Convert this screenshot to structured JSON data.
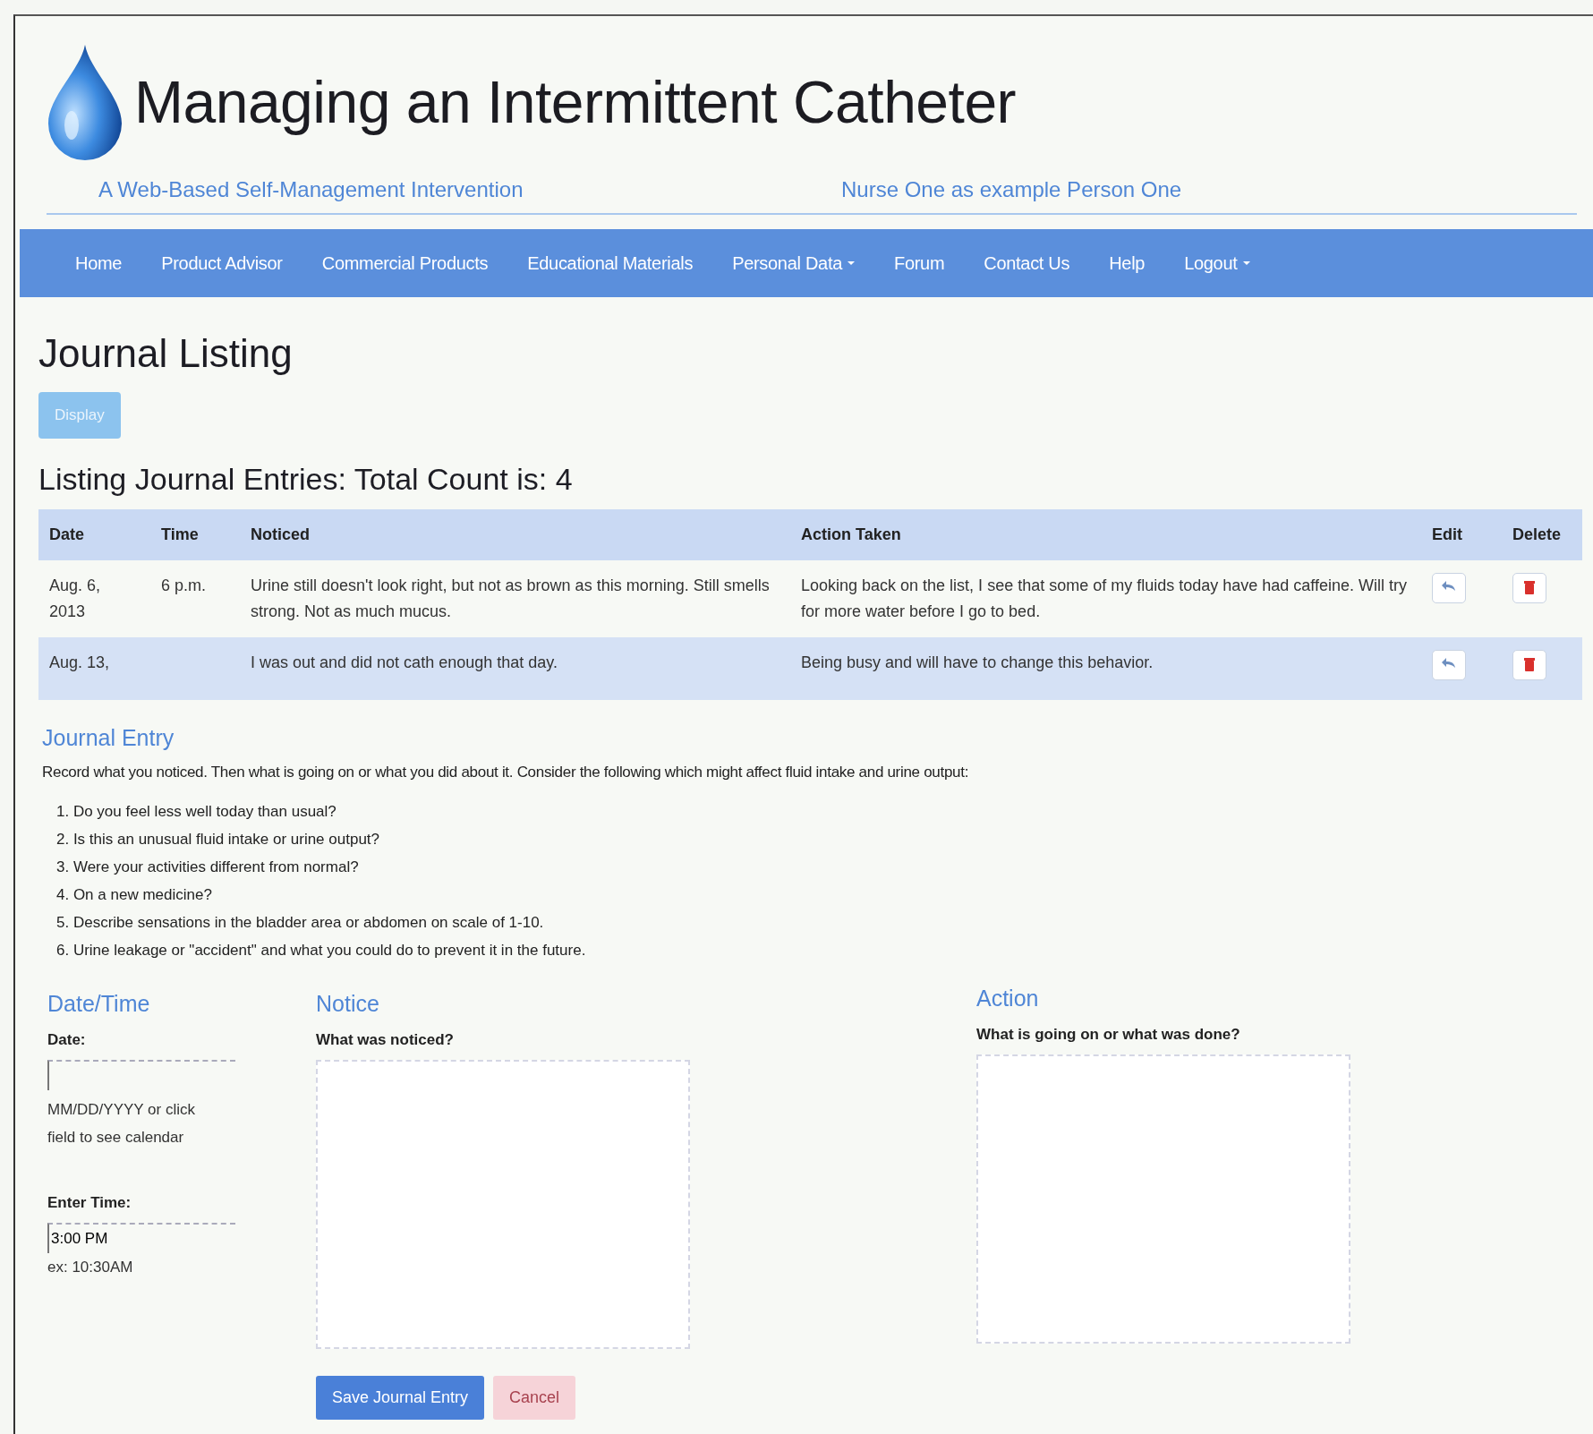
{
  "header": {
    "title": "Managing an Intermittent Catheter",
    "tagline": "A Web-Based Self-Management Intervention",
    "user": "Nurse One as example Person One"
  },
  "nav": [
    {
      "label": "Home",
      "dropdown": false
    },
    {
      "label": "Product Advisor",
      "dropdown": false
    },
    {
      "label": "Commercial Products",
      "dropdown": false
    },
    {
      "label": "Educational Materials",
      "dropdown": false
    },
    {
      "label": "Personal Data",
      "dropdown": true
    },
    {
      "label": "Forum",
      "dropdown": false
    },
    {
      "label": "Contact Us",
      "dropdown": false
    },
    {
      "label": "Help",
      "dropdown": false
    },
    {
      "label": "Logout",
      "dropdown": true
    }
  ],
  "listing": {
    "title": "Journal Listing",
    "display_button": {
      "label": "Display",
      "disabled": true
    },
    "subtitle": "Listing Journal Entries: Total Count is: 4",
    "columns": [
      "Date",
      "Time",
      "Noticed",
      "Action Taken",
      "Edit",
      "Delete"
    ],
    "rows": [
      {
        "date": "Aug. 6, 2013",
        "time": "6 p.m.",
        "noticed": "Urine still doesn't look right, but not as brown as this morning. Still smells strong. Not as much mucus.",
        "action": "Looking back on the list, I see that some of my fluids today have had caffeine. Will try for more water before I go to bed."
      },
      {
        "date": "Aug. 13,",
        "time": "",
        "noticed": "I was out and did not cath enough that day.",
        "action": "Being busy and will have to change this behavior."
      }
    ]
  },
  "entry": {
    "title": "Journal Entry",
    "intro": "Record what you noticed. Then what is going on or what you did about it. Consider the following which might affect fluid intake and urine output:",
    "questions": [
      "1. Do you feel less well today than usual?",
      "2. Is this an unusual fluid intake or urine output?",
      "3. Were your activities different from normal?",
      "4. On a new medicine?",
      "5. Describe sensations in the bladder area or abdomen on scale of 1-10.",
      "6. Urine leakage or \"accident\" and what you could do to prevent it in the future."
    ],
    "datetime": {
      "heading": "Date/Time",
      "date_label": "Date:",
      "date_hint": "MM/DD/YYYY or click field to see calendar",
      "time_label": "Enter Time:",
      "time_value": "3:00 PM",
      "time_hint": "ex: 10:30AM"
    },
    "notice": {
      "heading": "Notice",
      "label": "What was noticed?"
    },
    "action": {
      "heading": "Action",
      "label": "What is going on or what was done?"
    },
    "buttons": [
      {
        "label": "Save Journal Entry",
        "kind": "primary",
        "disabled": false
      },
      {
        "label": "Cancel",
        "kind": "danger",
        "disabled": true
      }
    ]
  }
}
